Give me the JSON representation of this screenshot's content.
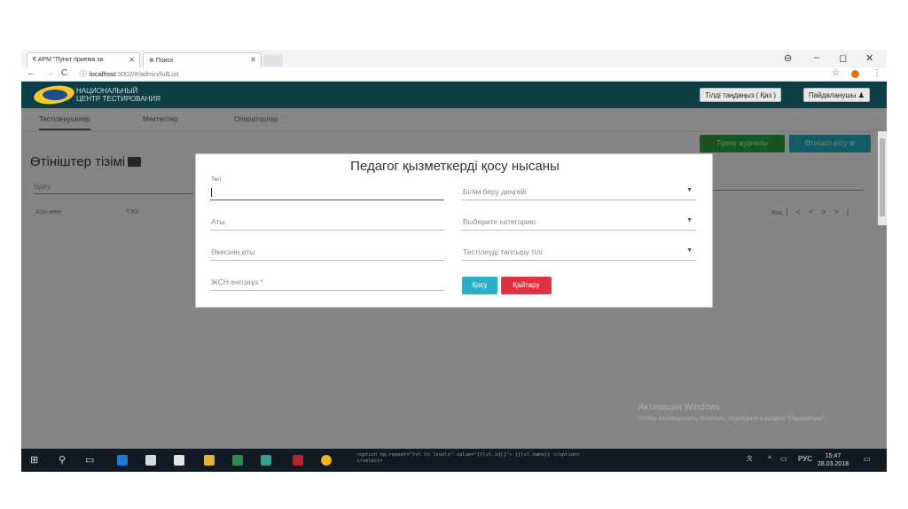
{
  "browser": {
    "tabs": [
      {
        "label": "АРМ \"Пункт приема за"
      },
      {
        "label": "Поиск"
      }
    ],
    "url_host": "localhost",
    "url_path": ":3002/#/admin/fullList",
    "window_minimize": "–",
    "window_restore": "◻",
    "window_close": "✕"
  },
  "header": {
    "brand_line1": "НАЦИОНАЛЬНЫЙ",
    "brand_line2": "ЦЕНТР ТЕСТИРОВАНИЯ",
    "language_button": "Тілді таңдаңыз ( Қаз )",
    "user_button": "Пайдаланушы ♟"
  },
  "nav": {
    "tabs": [
      "Тестіленушілер",
      "Мектептер",
      "Операторлар"
    ]
  },
  "page": {
    "title": "Өтініштер тізімі",
    "search_placeholder": "Іздеу",
    "columns": [
      "Аты-жөні",
      "ТЖК"
    ],
    "pager_label": "Жоқ",
    "journal_button": "Тіркеу журналы",
    "add_request_button": "Өтінішті қосу"
  },
  "modal": {
    "title": "Педагог қызметкерді қосу нысаны",
    "fields": {
      "surname": "Тегі",
      "name": "Аты",
      "patronymic": "Әкесінің аты",
      "iin": "ЖСН енгізіңіз *",
      "education_level": "Білім беру деңгейі",
      "category": "Выберите категорию",
      "test_language": "Тестілеуді тапсыру тілі"
    },
    "add_button": "Қосу",
    "cancel_button": "Қайтару"
  },
  "watermark": {
    "title": "Активация Windows",
    "subtitle": "Чтобы активировать Windows, перейдите в раздел \"Параметры\"."
  },
  "taskbar": {
    "code_line1": "<option ng-repeat=\"lvl in levels\" value=\"{{lvl.id}}\"> {{lvl.name}} </option>",
    "code_line2": "</select>",
    "language": "РУС",
    "time": "15:47",
    "date": "28.03.2018"
  },
  "colors": {
    "header_bg": "#0e3f46",
    "green": "#2f9a3f",
    "teal": "#20a7bb",
    "danger": "#e03140",
    "add": "#2ab0c6"
  }
}
